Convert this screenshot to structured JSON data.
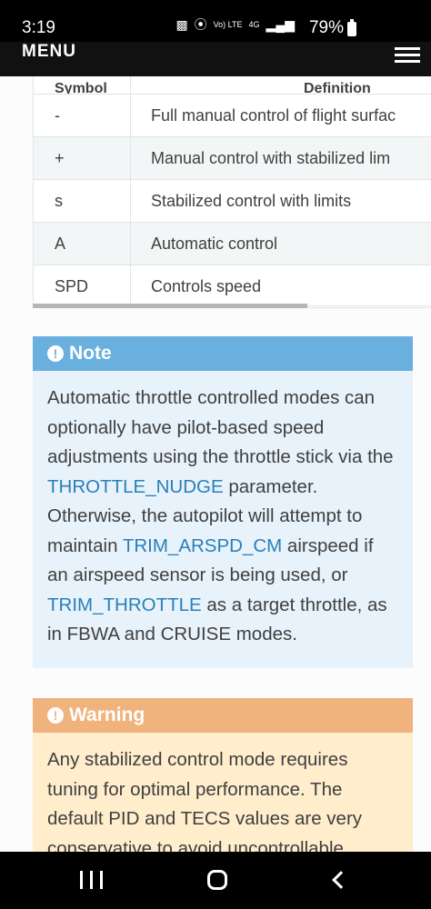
{
  "status_bar": {
    "time": "3:19",
    "battery_pct": "79%",
    "network": "4G",
    "volte": "Vo) LTE"
  },
  "topbar": {
    "menu_label": "MENU"
  },
  "table": {
    "headers": [
      "Symbol",
      "Definition"
    ],
    "rows": [
      {
        "symbol": "-",
        "definition": "Full manual control of flight surfac"
      },
      {
        "symbol": "+",
        "definition": "Manual control with stabilized lim"
      },
      {
        "symbol": "s",
        "definition": "Stabilized control with limits"
      },
      {
        "symbol": "A",
        "definition": "Automatic control"
      },
      {
        "symbol": "SPD",
        "definition": "Controls speed"
      }
    ]
  },
  "note": {
    "title": "Note",
    "text_1": "Automatic throttle controlled modes can optionally have pilot-based speed adjustments using the throttle stick via the ",
    "link_1": "THROTTLE_NUDGE",
    "text_2": " parameter. Otherwise, the autopilot will attempt to maintain ",
    "link_2": "TRIM_ARSPD_CM",
    "text_3": " airspeed if an airspeed sensor is being used, or ",
    "link_3": "TRIM_THROTTLE",
    "text_4": " as a target throttle, as in FBWA and CRUISE modes."
  },
  "warning": {
    "title": "Warning",
    "text": "Any stabilized control mode requires tuning for optimal performance. The default PID and TECS values are very conservative to avoid uncontrollable"
  },
  "colors": {
    "note_header": "#6ab0de",
    "note_body": "#e7f2fa",
    "warning_header": "#f0b37e",
    "warning_body": "#ffedcc",
    "link": "#2980b9"
  }
}
